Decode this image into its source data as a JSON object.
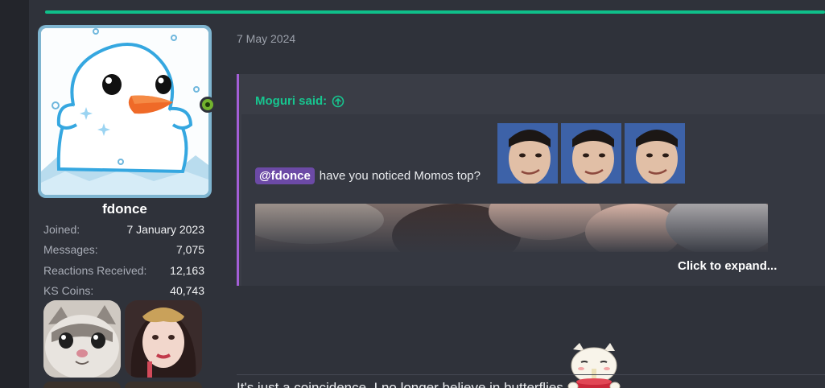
{
  "user": {
    "username": "fdonce",
    "online": true,
    "stats": [
      {
        "label": "Joined:",
        "value": "7 January 2023"
      },
      {
        "label": "Messages:",
        "value": "7,075"
      },
      {
        "label": "Reactions Received:",
        "value": "12,163"
      },
      {
        "label": "KS Coins:",
        "value": "40,743"
      }
    ],
    "badges": [
      "cat-badge",
      "girl-badge"
    ]
  },
  "post": {
    "date": "7 May 2024",
    "quote": {
      "author_label": "Moguri said:",
      "mention": "@fdonce",
      "text": "have you noticed Momos top?",
      "expand_label": "Click to expand..."
    },
    "reply_text": "It's just a coincidence. I no longer believe in butterflies"
  },
  "colors": {
    "accent": "#0fbf8a",
    "quote_author": "#17c58f",
    "quote_border": "#a35fd6",
    "mention_bg": "#6c4aa6",
    "online": "#72b32e"
  },
  "icons": [
    "up-circle-icon",
    "online-status-icon"
  ]
}
